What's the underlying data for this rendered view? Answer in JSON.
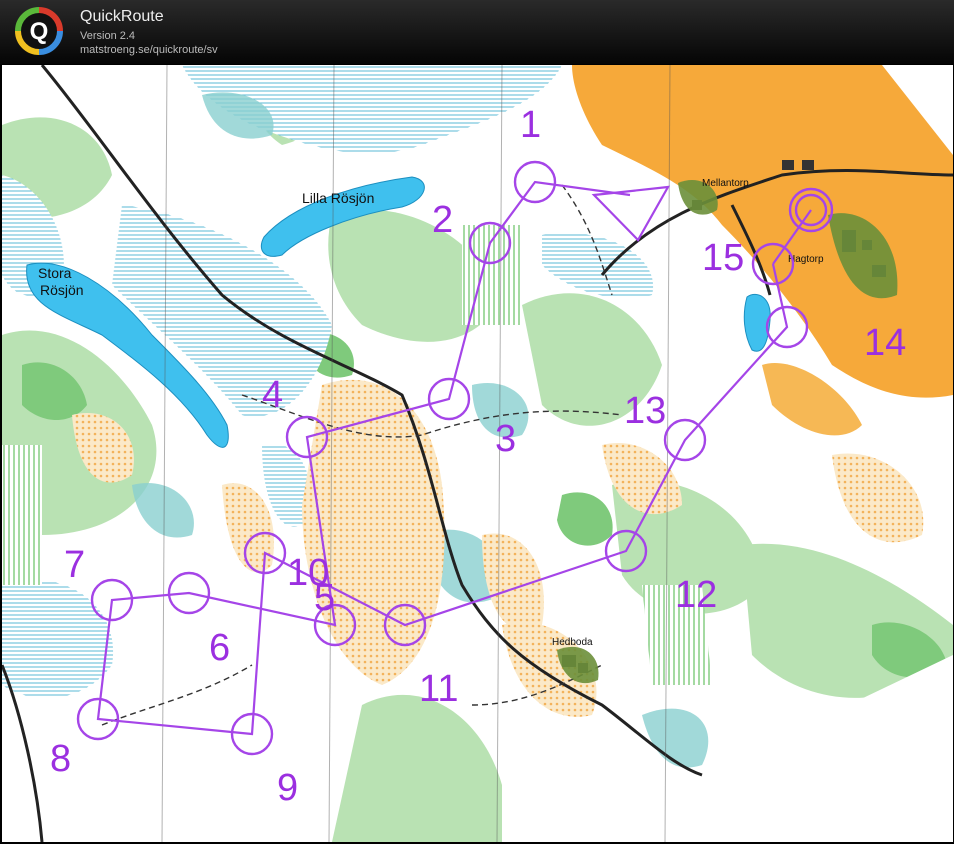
{
  "header": {
    "title": "QuickRoute",
    "version": "Version 2.4",
    "url": "matstroeng.se/quickroute/sv",
    "logo_letter": "Q"
  },
  "map": {
    "place_labels": [
      "Lilla Rösjön",
      "Stora",
      "Rösjön",
      "Mellantorp",
      "Hagtorp",
      "Hedboda"
    ],
    "controls": [
      {
        "number": "1"
      },
      {
        "number": "2"
      },
      {
        "number": "3"
      },
      {
        "number": "4"
      },
      {
        "number": "5"
      },
      {
        "number": "6"
      },
      {
        "number": "7"
      },
      {
        "number": "8"
      },
      {
        "number": "9"
      },
      {
        "number": "10"
      },
      {
        "number": "11"
      },
      {
        "number": "12"
      },
      {
        "number": "13"
      },
      {
        "number": "14"
      },
      {
        "number": "15"
      }
    ],
    "colors": {
      "course": "#a545e8",
      "course_number": "#9b2fe0",
      "water": "#3fc0ee",
      "marsh": "#6fc4d8",
      "forest_green": "#9fd39a",
      "open_yellow": "#f5a623",
      "rough_open": "#f7d9a6",
      "road": "#222222"
    }
  }
}
